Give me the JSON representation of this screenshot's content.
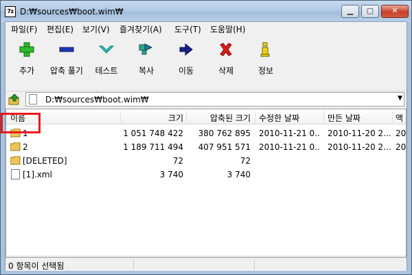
{
  "window": {
    "title": "D:₩sources₩boot.wim₩",
    "app_icon_text": "7z"
  },
  "window_buttons": {
    "minimize": "▁",
    "maximize": "▢",
    "close": "✕"
  },
  "menu": [
    "파일(F)",
    "편집(E)",
    "보기(V)",
    "즐겨찾기(A)",
    "도구(T)",
    "도움말(H)"
  ],
  "toolbar": [
    {
      "label": "추가",
      "icon": "add-icon"
    },
    {
      "label": "압축 풀기",
      "icon": "extract-icon"
    },
    {
      "label": "테스트",
      "icon": "test-icon"
    },
    {
      "label": "복사",
      "icon": "copy-icon"
    },
    {
      "label": "이동",
      "icon": "move-icon"
    },
    {
      "label": "삭제",
      "icon": "delete-icon"
    },
    {
      "label": "정보",
      "icon": "info-icon"
    }
  ],
  "address": {
    "path": "D:₩sources₩boot.wim₩"
  },
  "columns": [
    "이름",
    "크기",
    "압축된 크기",
    "수정한 날짜",
    "만든 날짜",
    "액"
  ],
  "files": [
    {
      "name": "1",
      "size": "1 051 748 422",
      "packed": "380 762 895",
      "modified": "2010-11-21 0...",
      "created": "2010-11-20 2...",
      "extra": "20",
      "type": "folder"
    },
    {
      "name": "2",
      "size": "1 189 711 494",
      "packed": "407 951 571",
      "modified": "2010-11-21 0...",
      "created": "2010-11-20 2...",
      "extra": "20",
      "type": "folder"
    },
    {
      "name": "[DELETED]",
      "size": "72",
      "packed": "72",
      "modified": "",
      "created": "",
      "extra": "",
      "type": "folder"
    },
    {
      "name": "[1].xml",
      "size": "3 740",
      "packed": "3 740",
      "modified": "",
      "created": "",
      "extra": "",
      "type": "xml"
    }
  ],
  "status": {
    "text": "0 항목이 선택됨"
  },
  "colors": {
    "titlebar": "#b3cbe6",
    "highlight": "#e8191c",
    "close": "#c8412a"
  }
}
